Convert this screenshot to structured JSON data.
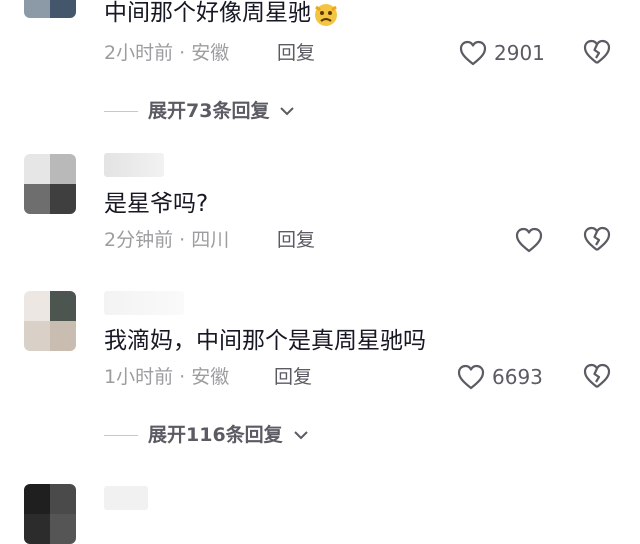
{
  "comments": [
    {
      "text": "中间那个好像周星驰",
      "emoji": "crying-face-emoji",
      "time": "2小时前",
      "location": "安徽",
      "reply_label": "回复",
      "likes": "2901"
    },
    {
      "text": "是星爷吗?",
      "time": "2分钟前",
      "location": "四川",
      "reply_label": "回复",
      "likes": ""
    },
    {
      "text": "我滴妈，中间那个是真周星驰吗",
      "time": "1小时前",
      "location": "安徽",
      "reply_label": "回复",
      "likes": "6693"
    }
  ],
  "expanders": [
    {
      "label": "展开73条回复"
    },
    {
      "label": "展开116条回复"
    }
  ],
  "separator": "·",
  "colors": {
    "meta": "#9d9da0",
    "action": "#5a5b63",
    "text": "#161823"
  }
}
